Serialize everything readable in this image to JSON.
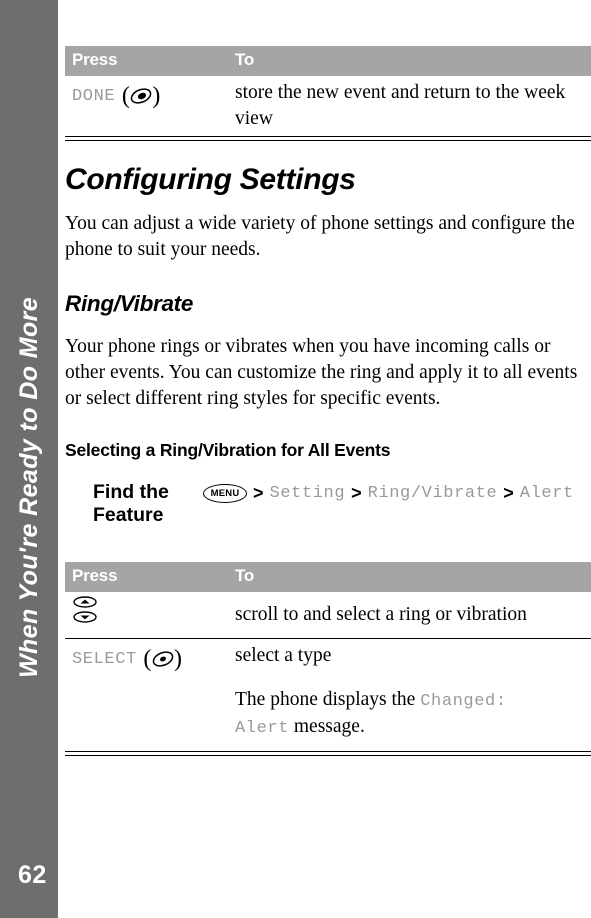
{
  "page": {
    "number": "62",
    "tab_label": "When You're Ready to Do More",
    "sidebar_color": "#6e6e6e",
    "table_header_color": "#a5a5a5",
    "mono_text_color": "#9a9a9a"
  },
  "table_top": {
    "headers": {
      "press": "Press",
      "to": "To"
    },
    "rows": [
      {
        "press_text": "DONE",
        "press_icon": "softkey-right-icon",
        "to_text": "store the new event and return to the week view"
      }
    ]
  },
  "section": {
    "title": "Configuring Settings",
    "intro": "You can adjust a wide variety of phone settings and configure the phone to suit your needs."
  },
  "subsection": {
    "title": "Ring/Vibrate",
    "body": "Your phone rings or vibrates when you have incoming calls or other events. You can customize the ring and apply it to all events or select different ring styles for specific events."
  },
  "procedure": {
    "title": "Selecting a Ring/Vibration for All Events",
    "find_feature": {
      "label_line1": "Find the",
      "label_line2": "Feature",
      "menu_key": "MENU",
      "separator": ">",
      "path": [
        "Setting",
        "Ring/Vibrate",
        "Alert"
      ]
    }
  },
  "table_bottom": {
    "headers": {
      "press": "Press",
      "to": "To"
    },
    "rows": [
      {
        "press_text": "",
        "press_icon": "scroll-updown-key-icon",
        "to_text": "scroll to and select a ring or vibration"
      },
      {
        "press_text": "SELECT",
        "press_icon": "softkey-center-icon",
        "to_text": "select a type",
        "note_prefix": "The phone displays the ",
        "note_mono": "Changed: Alert",
        "note_suffix": " message."
      }
    ]
  }
}
